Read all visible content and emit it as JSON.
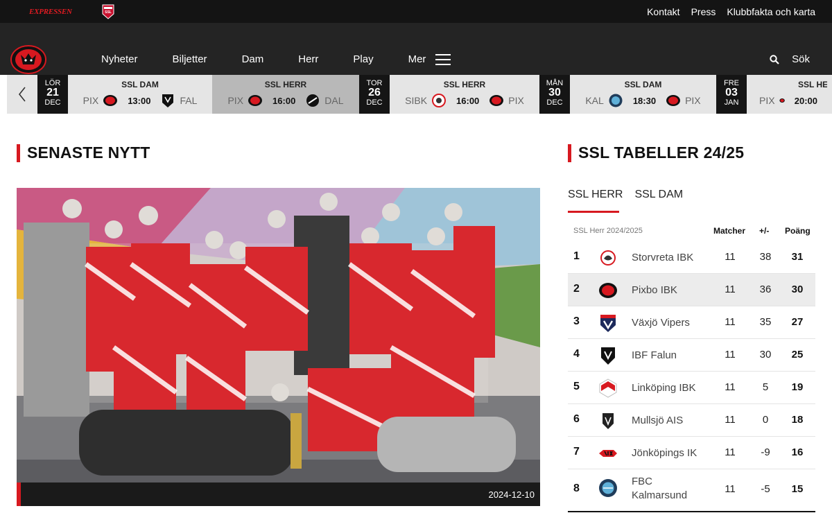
{
  "topbar": {
    "brand": "EXPRESSEN",
    "links": [
      "Kontakt",
      "Press",
      "Klubbfakta och karta"
    ]
  },
  "nav": {
    "items": [
      "Nyheter",
      "Biljetter",
      "Dam",
      "Herr",
      "Play",
      "Mer"
    ],
    "search_label": "Sök"
  },
  "strip": {
    "dates": [
      {
        "dow": "LÖR",
        "day": "21",
        "month": "DEC"
      },
      {
        "dow": "TOR",
        "day": "26",
        "month": "DEC"
      },
      {
        "dow": "MÅN",
        "day": "30",
        "month": "DEC"
      },
      {
        "dow": "FRE",
        "day": "03",
        "month": "JAN"
      }
    ],
    "matches": [
      {
        "league": "SSL DAM",
        "home": "PIX",
        "time": "13:00",
        "away": "FAL"
      },
      {
        "league": "SSL HERR",
        "home": "PIX",
        "time": "16:00",
        "away": "DAL"
      },
      {
        "league": "SSL HERR",
        "home": "SIBK",
        "time": "16:00",
        "away": "PIX"
      },
      {
        "league": "SSL DAM",
        "home": "KAL",
        "time": "18:30",
        "away": "PIX"
      },
      {
        "league": "SSL HERR",
        "home": "PIX",
        "time": "20:00",
        "away": ""
      }
    ]
  },
  "news": {
    "heading": "SENASTE NYTT",
    "date": "2024-12-10"
  },
  "table": {
    "heading": "SSL TABELLER 24/25",
    "tabs": [
      "SSL HERR",
      "SSL DAM"
    ],
    "season": "SSL Herr 2024/2025",
    "col_matches": "Matcher",
    "col_diff": "+/-",
    "col_points": "Poäng",
    "rows": [
      {
        "pos": "1",
        "team": "Storvreta IBK",
        "m": "11",
        "gd": "38",
        "pts": "31"
      },
      {
        "pos": "2",
        "team": "Pixbo IBK",
        "m": "11",
        "gd": "36",
        "pts": "30"
      },
      {
        "pos": "3",
        "team": "Växjö Vipers",
        "m": "11",
        "gd": "35",
        "pts": "27"
      },
      {
        "pos": "4",
        "team": "IBF Falun",
        "m": "11",
        "gd": "30",
        "pts": "25"
      },
      {
        "pos": "5",
        "team": "Linköping IBK",
        "m": "11",
        "gd": "5",
        "pts": "19"
      },
      {
        "pos": "6",
        "team": "Mullsjö AIS",
        "m": "11",
        "gd": "0",
        "pts": "18"
      },
      {
        "pos": "7",
        "team": "Jönköpings IK",
        "m": "11",
        "gd": "-9",
        "pts": "16"
      },
      {
        "pos": "8",
        "team": "FBC",
        "team2": "Kalmarsund",
        "m": "11",
        "gd": "-5",
        "pts": "15"
      }
    ]
  },
  "colors": {
    "accent": "#d71920",
    "dark": "#141414",
    "nav": "#242424"
  }
}
